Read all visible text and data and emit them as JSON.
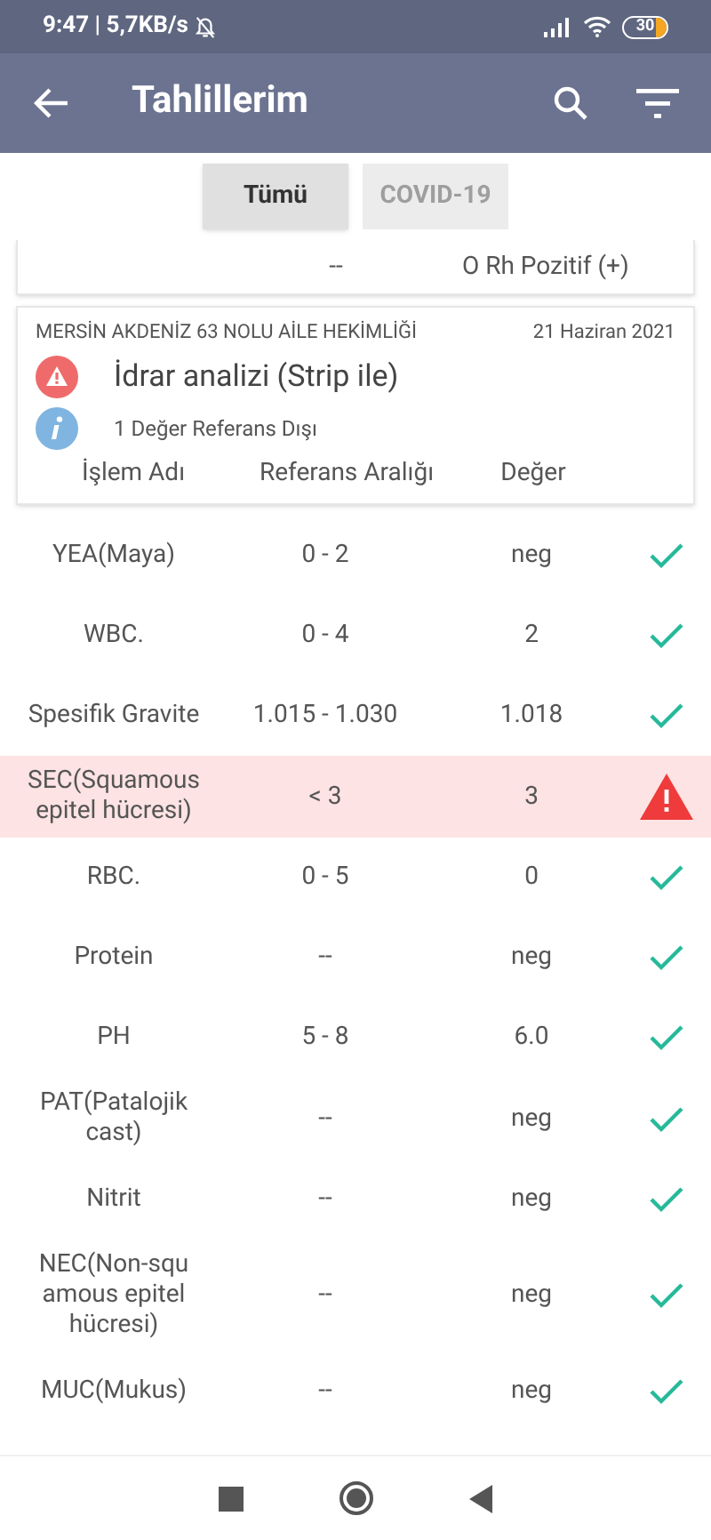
{
  "status_bar": {
    "left": "9:47 | 5,7KB/s",
    "battery": "30"
  },
  "app_bar": {
    "title": "Tahlillerim"
  },
  "tabs": [
    {
      "label": "Tümü",
      "selected": true
    },
    {
      "label": "COVID-19",
      "selected": false
    }
  ],
  "previous_card": {
    "reference": "--",
    "value": "O Rh Pozitif (+)"
  },
  "card": {
    "lab": "MERSİN AKDENİZ 63 NOLU AİLE HEKİMLİĞİ",
    "date": "21 Haziran 2021",
    "test": "İdrar analizi (Strip ile)",
    "info": "1 Değer Referans Dışı",
    "columns": [
      "İşlem Adı",
      "Referans Aralığı",
      "Değer"
    ]
  },
  "rows": [
    {
      "name": "YEA(Maya)",
      "range": "0 - 2",
      "value": "neg",
      "out_of_range": false
    },
    {
      "name": "WBC.",
      "range": "0 - 4",
      "value": "2",
      "out_of_range": false
    },
    {
      "name": "Spesifik Gravite",
      "range": "1.015 - 1.030",
      "value": "1.018",
      "out_of_range": false
    },
    {
      "name": "SEC(Squamous epitel hücresi)",
      "range": "< 3",
      "value": "3",
      "out_of_range": true
    },
    {
      "name": "RBC.",
      "range": "0 - 5",
      "value": "0",
      "out_of_range": false
    },
    {
      "name": "Protein",
      "range": "--",
      "value": "neg",
      "out_of_range": false
    },
    {
      "name": "PH",
      "range": "5 - 8",
      "value": "6.0",
      "out_of_range": false
    },
    {
      "name": "PAT(Patalojik cast)",
      "range": "--",
      "value": "neg",
      "out_of_range": false
    },
    {
      "name": "Nitrit",
      "range": "--",
      "value": "neg",
      "out_of_range": false
    },
    {
      "name": "NEC(Non-squ amous epitel hücresi)",
      "range": "--",
      "value": "neg",
      "out_of_range": false
    },
    {
      "name": "MUC(Mukus)",
      "range": "--",
      "value": "neg",
      "out_of_range": false
    }
  ]
}
